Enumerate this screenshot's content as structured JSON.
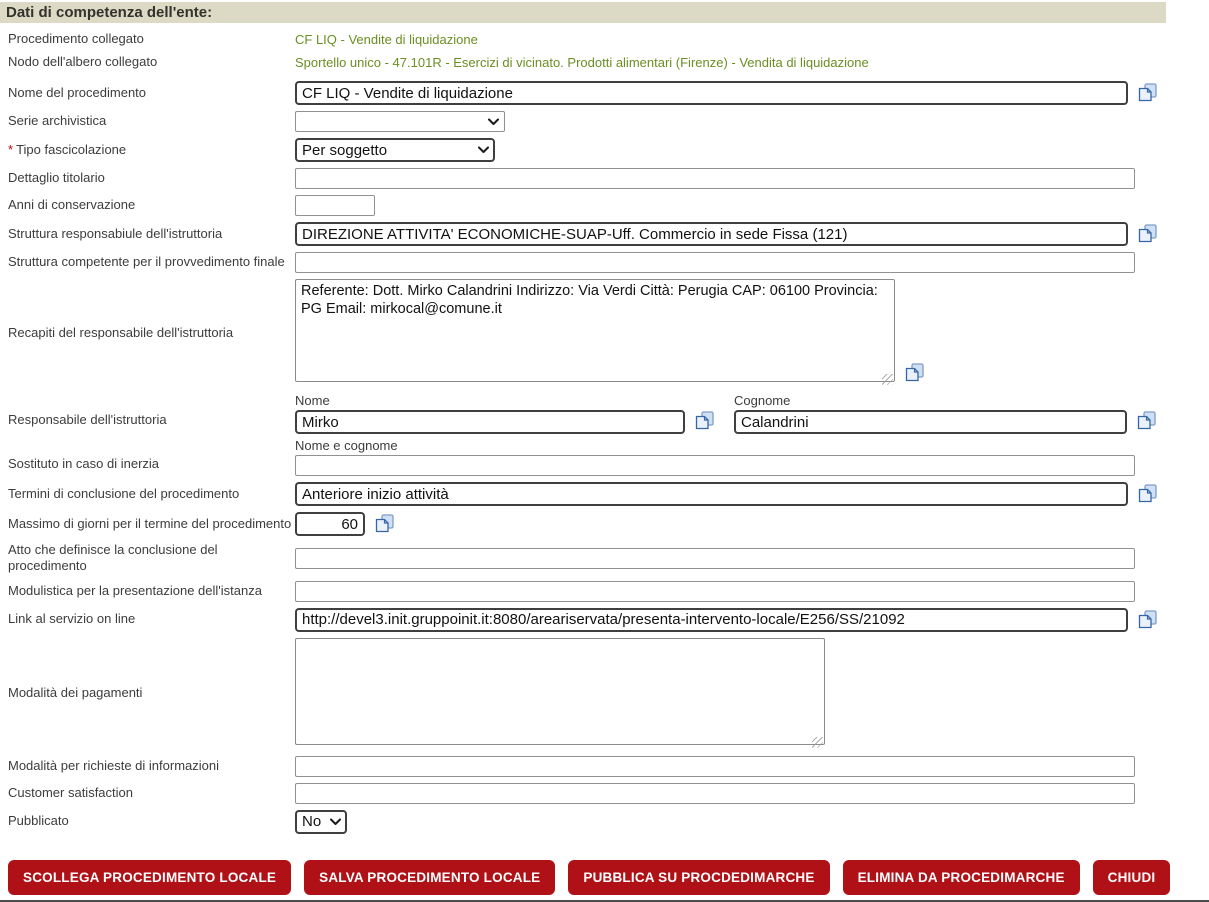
{
  "header": {
    "title": "Dati di competenza dell'ente:"
  },
  "colors": {
    "header_bg": "#dcd9c4",
    "link_green": "#6b8e23",
    "button_red": "#b01117",
    "required_red": "#cc0000"
  },
  "icons": {
    "copy": "copy-icon (two overlapping blue pages)",
    "select_chevron": "chevron-down-icon"
  },
  "readonly_rows": [
    {
      "label": "Procedimento collegato",
      "value": "CF LIQ - Vendite di liquidazione"
    },
    {
      "label": "Nodo dell'albero collegato",
      "value": "Sportello unico - 47.101R - Esercizi di vicinato. Prodotti alimentari (Firenze) - Vendita di liquidazione"
    }
  ],
  "fields": {
    "nome_procedimento": {
      "label": "Nome del procedimento",
      "value": "CF LIQ - Vendite di liquidazione"
    },
    "serie_archivistica": {
      "label": "Serie archivistica",
      "value": ""
    },
    "tipo_fascicolazione": {
      "label": "Tipo fascicolazione",
      "required_mark": "*",
      "value": "Per soggetto"
    },
    "dettaglio_titolario": {
      "label": "Dettaglio titolario",
      "value": ""
    },
    "anni_conservazione": {
      "label": "Anni di conservazione",
      "value": ""
    },
    "struttura_responsabile": {
      "label": "Struttura responsabiule dell'istruttoria",
      "value": "DIREZIONE ATTIVITA' ECONOMICHE-SUAP-Uff. Commercio in sede Fissa (121)"
    },
    "struttura_competente": {
      "label": "Struttura competente per il provvedimento finale",
      "value": ""
    },
    "recapiti": {
      "label": "Recapiti del responsabile dell'istruttoria",
      "value": "Referente: Dott. Mirko Calandrini Indirizzo: Via Verdi Città: Perugia CAP: 06100 Provincia: PG Email: mirkocal@comune.it"
    },
    "responsabile": {
      "label": "Responsabile dell'istruttoria",
      "nome_label": "Nome",
      "nome_value": "Mirko",
      "cognome_label": "Cognome",
      "cognome_value": "Calandrini"
    },
    "sostituto": {
      "label": "Sostituto in caso di inerzia",
      "sub_label": "Nome e cognome",
      "value": ""
    },
    "termini": {
      "label": "Termini di conclusione del procedimento",
      "value": "Anteriore inizio attività"
    },
    "massimo_giorni": {
      "label": "Massimo di giorni per il termine del procedimento",
      "value": "60"
    },
    "atto_conclusione": {
      "label": "Atto che definisce la conclusione del procedimento",
      "value": ""
    },
    "modulistica": {
      "label": "Modulistica per la presentazione dell'istanza",
      "value": ""
    },
    "link_servizio": {
      "label": "Link al servizio on line",
      "value": "http://devel3.init.gruppoinit.it:8080/areariservata/presenta-intervento-locale/E256/SS/21092"
    },
    "modalita_pagamenti": {
      "label": "Modalità dei pagamenti",
      "value": ""
    },
    "modalita_richieste": {
      "label": "Modalità per richieste di informazioni",
      "value": ""
    },
    "customer_satisfaction": {
      "label": "Customer satisfaction",
      "value": ""
    },
    "pubblicato": {
      "label": "Pubblicato",
      "value": "No"
    }
  },
  "buttons": [
    {
      "label": "SCOLLEGA PROCEDIMENTO LOCALE"
    },
    {
      "label": "SALVA PROCEDIMENTO LOCALE"
    },
    {
      "label": "PUBBLICA SU PROCDEDIMARCHE"
    },
    {
      "label": "ELIMINA DA PROCEDIMARCHE"
    },
    {
      "label": "CHIUDI"
    }
  ]
}
